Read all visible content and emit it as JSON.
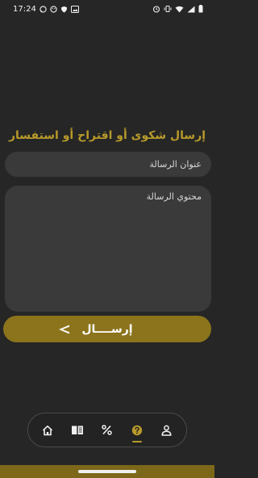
{
  "status_bar": {
    "time": "17:24",
    "left_icons": [
      "whatsapp-icon",
      "emoji-icon",
      "shield-icon",
      "gallery-icon"
    ],
    "right_icons": [
      "alarm-icon",
      "vibrate-icon",
      "wifi-icon",
      "signal-icon",
      "battery-icon"
    ]
  },
  "form": {
    "title": "إرسال شكوى أو اقتراح أو استفسار",
    "subject_placeholder": "عنوان الرسالة",
    "message_placeholder": "محتوي الرسالة",
    "send_label": "إرســــال"
  },
  "bottom_nav": {
    "items": [
      {
        "icon": "home-icon"
      },
      {
        "icon": "book-icon"
      },
      {
        "icon": "percent-icon"
      },
      {
        "icon": "help-icon",
        "active": true
      },
      {
        "icon": "profile-icon"
      }
    ]
  },
  "colors": {
    "accent": "#b79a2a",
    "button": "#8b741c",
    "background": "#262626",
    "field": "#3a3a3a"
  }
}
